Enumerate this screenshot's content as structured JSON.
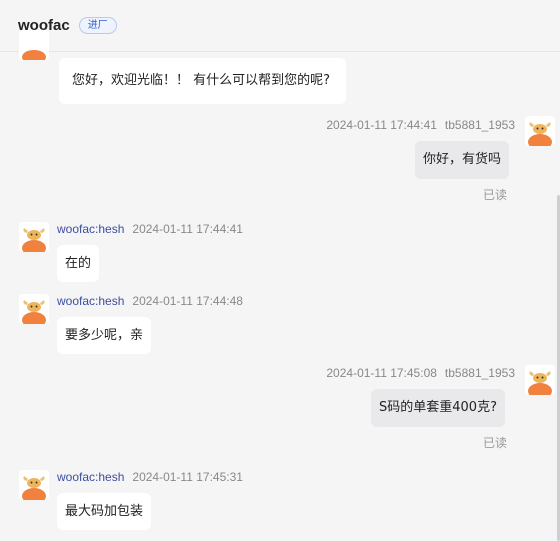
{
  "header": {
    "title": "woofac",
    "badge": "进厂"
  },
  "messages": [
    {
      "side": "left",
      "text": "您好，欢迎光临！！ 有什么可以帮到您的呢?"
    },
    {
      "side": "right",
      "time": "2024-01-11 17:44:41",
      "user": "tb5881_1953",
      "text": "你好，有货吗",
      "status": "已读"
    },
    {
      "side": "left",
      "name": "woofac:hesh",
      "time": "2024-01-11 17:44:41",
      "text": "在的"
    },
    {
      "side": "left",
      "name": "woofac:hesh",
      "time": "2024-01-11 17:44:48",
      "text": "要多少呢，亲"
    },
    {
      "side": "right",
      "time": "2024-01-11 17:45:08",
      "user": "tb5881_1953",
      "text": "S码的单套重400克?",
      "status": "已读"
    },
    {
      "side": "left",
      "name": "woofac:hesh",
      "time": "2024-01-11 17:45:31",
      "text": "最大码加包装"
    }
  ],
  "colors": {
    "background": "#f5f5f6",
    "left_bubble": "#ffffff",
    "right_bubble": "#e9e9eb",
    "agent_name": "#3c4fa0",
    "badge": "#2f63d8",
    "avatar_orange": "#f0813f"
  },
  "icons": {
    "agent_avatar": "cow-avatar-icon",
    "customer_avatar": "cow-avatar-icon"
  }
}
